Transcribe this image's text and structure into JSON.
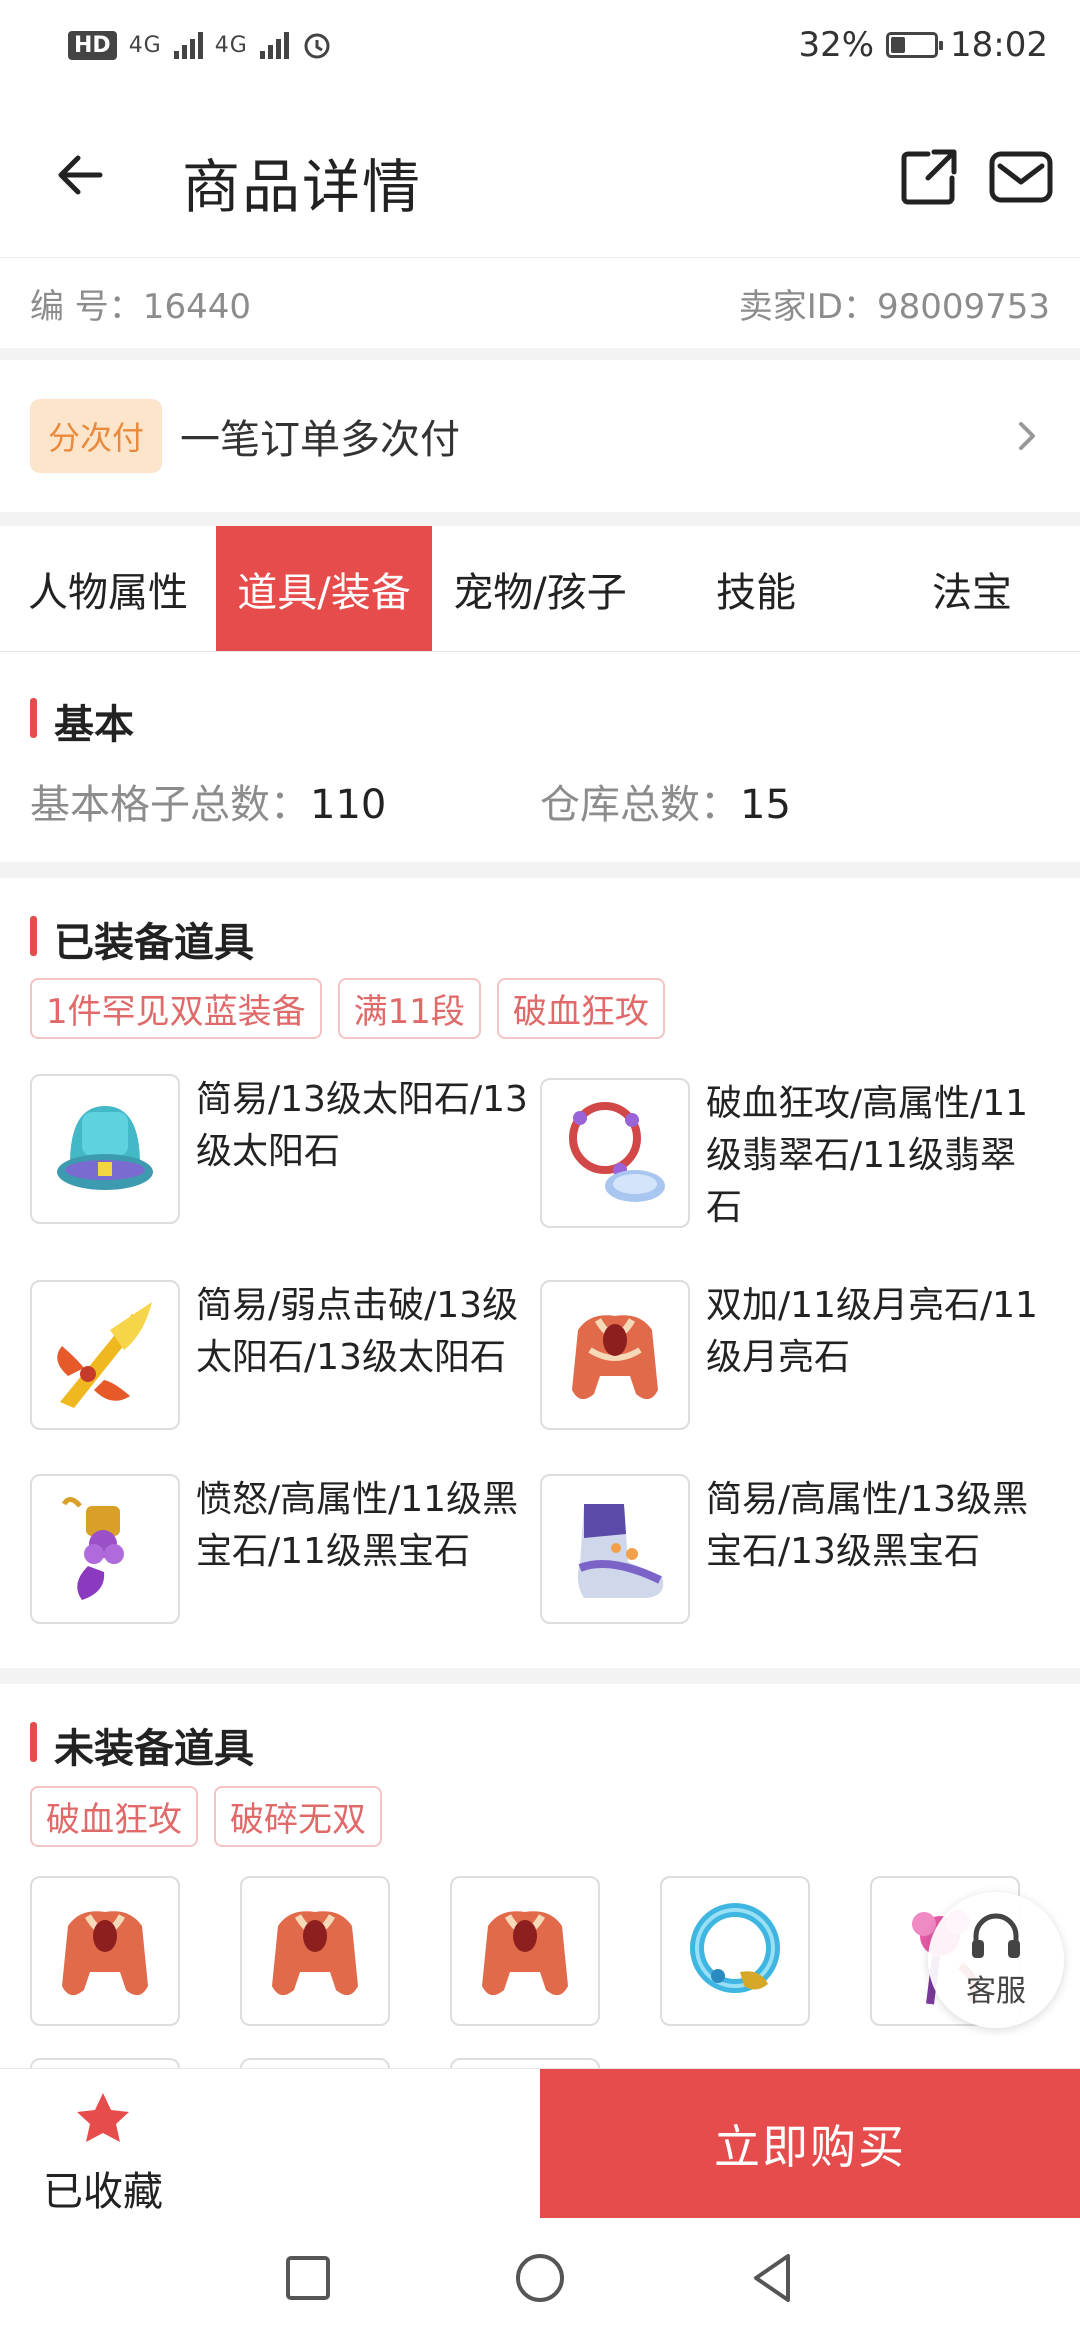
{
  "status_bar": {
    "hd": "HD",
    "sig1": "4G",
    "sig2": "4G",
    "battery_pct": "32%",
    "battery_level": 0.32,
    "time": "18:02"
  },
  "header": {
    "title": "商品详情"
  },
  "info": {
    "id_text": "编 号：16440",
    "seller_text": "卖家ID：98009753"
  },
  "installment": {
    "badge": "分次付",
    "text": "一笔订单多次付"
  },
  "tabs": [
    {
      "label": "人物属性",
      "active": false
    },
    {
      "label": "道具/装备",
      "active": true
    },
    {
      "label": "宠物/孩子",
      "active": false
    },
    {
      "label": "技能",
      "active": false
    },
    {
      "label": "法宝",
      "active": false
    }
  ],
  "basic": {
    "title": "基本",
    "slots_label": "基本格子总数：",
    "slots_value": "110",
    "storage_label": "仓库总数：",
    "storage_value": "15"
  },
  "equipped": {
    "title": "已装备道具",
    "tags": [
      "1件罕见双蓝装备",
      "满11段",
      "破血狂攻"
    ],
    "items": [
      {
        "text": "简易/13级太阳石/13级太阳石",
        "icon": "helmet-icon"
      },
      {
        "text": "破血狂攻/高属性/11级翡翠石/11级翡翠石",
        "icon": "necklace-icon"
      },
      {
        "text": "简易/弱点击破/13级太阳石/13级太阳石",
        "icon": "sword-icon"
      },
      {
        "text": "双加/11级月亮石/11级月亮石",
        "icon": "armor-icon"
      },
      {
        "text": "愤怒/高属性/11级黑宝石/11级黑宝石",
        "icon": "belt-icon"
      },
      {
        "text": "简易/高属性/13级黑宝石/13级黑宝石",
        "icon": "boots-icon"
      }
    ]
  },
  "unequipped": {
    "title": "未装备道具",
    "tags": [
      "破血狂攻",
      "破碎无双"
    ],
    "items": [
      "armor-icon",
      "armor-icon",
      "armor-icon",
      "ring-icon",
      "flower-icon"
    ]
  },
  "customer_service": {
    "label": "客服"
  },
  "bottom": {
    "fav_label": "已收藏",
    "buy_label": "立即购买"
  },
  "colors": {
    "accent": "#e74c4c",
    "tag_text": "#e06a6a",
    "badge_bg": "#fde5cc",
    "badge_text": "#e98a3c"
  }
}
